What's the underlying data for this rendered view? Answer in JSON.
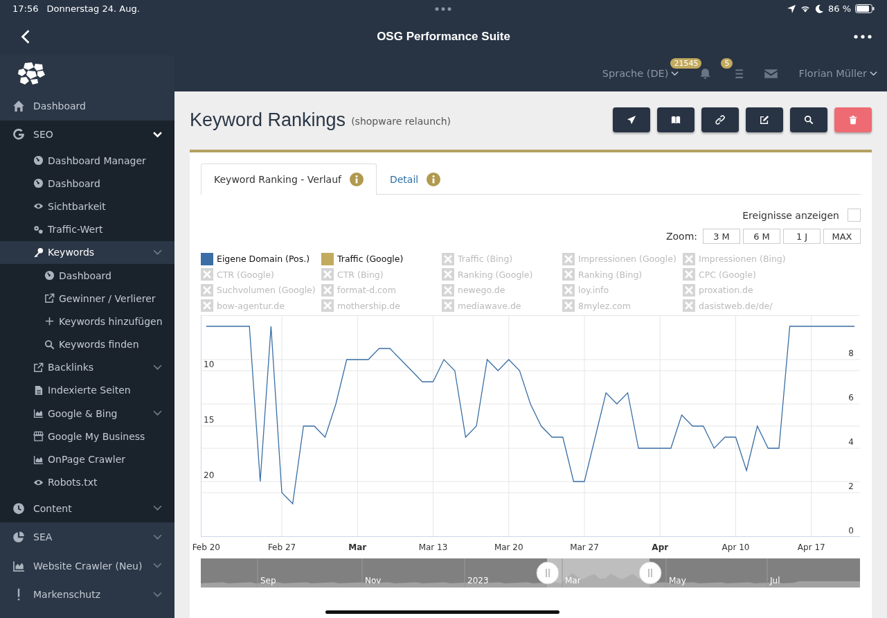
{
  "status_bar": {
    "time": "17:56",
    "date": "Donnerstag 24. Aug.",
    "battery": "86 %"
  },
  "title_bar": {
    "title": "OSG Performance Suite"
  },
  "header": {
    "language": "Sprache (DE)",
    "notifications_badge": "21545",
    "tasks_badge": "5",
    "user": "Florian Müller"
  },
  "sidebar": {
    "items": [
      {
        "label": "Dashboard",
        "selected": false
      },
      {
        "label": "SEO",
        "selected": false,
        "expanded": true,
        "children": [
          {
            "label": "Dashboard Manager",
            "selected": false
          },
          {
            "label": "Dashboard",
            "selected": false
          },
          {
            "label": "Sichtbarkeit",
            "selected": false
          },
          {
            "label": "Traffic-Wert",
            "selected": false
          },
          {
            "label": "Keywords",
            "selected": true,
            "expanded": true,
            "children": [
              {
                "label": "Dashboard",
                "selected": false
              },
              {
                "label": "Gewinner / Verlierer",
                "selected": false
              },
              {
                "label": "Keywords hinzufügen",
                "selected": false
              },
              {
                "label": "Keywords finden",
                "selected": false
              }
            ]
          },
          {
            "label": "Backlinks",
            "selected": false,
            "expanded": false
          },
          {
            "label": "Indexierte Seiten",
            "selected": false
          },
          {
            "label": "Google & Bing",
            "selected": false,
            "expanded": false
          },
          {
            "label": "Google My Business",
            "selected": false
          },
          {
            "label": "OnPage Crawler",
            "selected": false
          },
          {
            "label": "Robots.txt",
            "selected": false
          }
        ]
      },
      {
        "label": "Content",
        "selected": false,
        "expanded": false
      },
      {
        "label": "SEA",
        "selected": false,
        "expanded": false
      },
      {
        "label": "Website Crawler (Neu)",
        "selected": false,
        "expanded": false
      },
      {
        "label": "Markenschutz",
        "selected": false,
        "expanded": false
      }
    ]
  },
  "page": {
    "title": "Keyword Rankings",
    "subtitle": "(shopware relaunch)",
    "actions": [
      {
        "kind": "default"
      },
      {
        "kind": "default"
      },
      {
        "kind": "default"
      },
      {
        "kind": "default"
      },
      {
        "kind": "default"
      },
      {
        "kind": "danger"
      }
    ],
    "tabs": [
      {
        "label": "Keyword Ranking - Verlauf",
        "selected": true
      },
      {
        "label": "Detail",
        "selected": false
      }
    ],
    "events_toggle": {
      "label": "Ereignisse anzeigen",
      "checked": false
    },
    "zoom": {
      "label": "Zoom:",
      "options": [
        {
          "label": "3 M",
          "selected": false
        },
        {
          "label": "6 M",
          "selected": false
        },
        {
          "label": "1 J",
          "selected": false
        },
        {
          "label": "MAX",
          "selected": false
        }
      ]
    },
    "legend": [
      {
        "label": "Traffic (Google)",
        "enabled": true,
        "color": "#c2aa5e"
      },
      {
        "label": "Traffic (Bing)",
        "enabled": false
      },
      {
        "label": "Impressionen (Google)",
        "enabled": false
      },
      {
        "label": "Impressionen (Bing)",
        "enabled": false
      },
      {
        "label": "CTR (Google)",
        "enabled": false
      },
      {
        "label": "CTR (Bing)",
        "enabled": false
      },
      {
        "label": "Ranking (Google)",
        "enabled": false
      },
      {
        "label": "Ranking (Bing)",
        "enabled": false
      },
      {
        "label": "CPC (Google)",
        "enabled": false
      },
      {
        "label": "Suchvolumen (Google)",
        "enabled": false
      },
      {
        "label": "format-d.com",
        "enabled": false
      },
      {
        "label": "newego.de",
        "enabled": false
      },
      {
        "label": "loy.info",
        "enabled": false
      },
      {
        "label": "proxation.de",
        "enabled": false
      },
      {
        "label": "bow-agentur.de",
        "enabled": false
      },
      {
        "label": "mothership.de",
        "enabled": false
      },
      {
        "label": "mediawave.de",
        "enabled": false
      },
      {
        "label": "8mylez.com",
        "enabled": false
      },
      {
        "label": "dasistweb.de/de/",
        "enabled": false
      }
    ],
    "chart_data": {
      "type": "line",
      "categories": [
        "Feb 20",
        null,
        null,
        null,
        null,
        null,
        null,
        "Feb 27",
        null,
        null,
        null,
        null,
        null,
        null,
        "Mar",
        null,
        null,
        null,
        null,
        null,
        null,
        "Mar 13",
        null,
        null,
        null,
        null,
        null,
        null,
        "Mar 20",
        null,
        null,
        null,
        null,
        null,
        null,
        "Mar 27",
        null,
        null,
        null,
        null,
        null,
        null,
        "Apr",
        null,
        null,
        null,
        null,
        null,
        null,
        "Apr 10",
        null,
        null,
        null,
        null,
        null,
        null,
        "Apr 17",
        null,
        null,
        null,
        null
      ],
      "series": [
        {
          "name": "Eigene Domain (Pos.)",
          "color": "#3a6ea5",
          "values": [
            6,
            6,
            6,
            6,
            6,
            20,
            6,
            21,
            22,
            15,
            15,
            16,
            13,
            9,
            9,
            9,
            8,
            8,
            9,
            10,
            11,
            11,
            9,
            10,
            16,
            15,
            9,
            10,
            9,
            10,
            13,
            15,
            16,
            16,
            20,
            20,
            16,
            12,
            13,
            12,
            17,
            17,
            17,
            17,
            14,
            15,
            15,
            17,
            16,
            16,
            19,
            15,
            17,
            17,
            6,
            6,
            6,
            6,
            6,
            6,
            6
          ]
        }
      ],
      "ylim": [
        25,
        5
      ],
      "yticks": [
        10,
        15,
        20
      ],
      "grid": true,
      "annotations": [
        "0",
        "2",
        "4",
        "6",
        "8"
      ]
    },
    "navigator": {
      "labels": [
        "Sep",
        "Nov",
        "2023",
        "Mar",
        "May",
        "Jul"
      ]
    }
  }
}
